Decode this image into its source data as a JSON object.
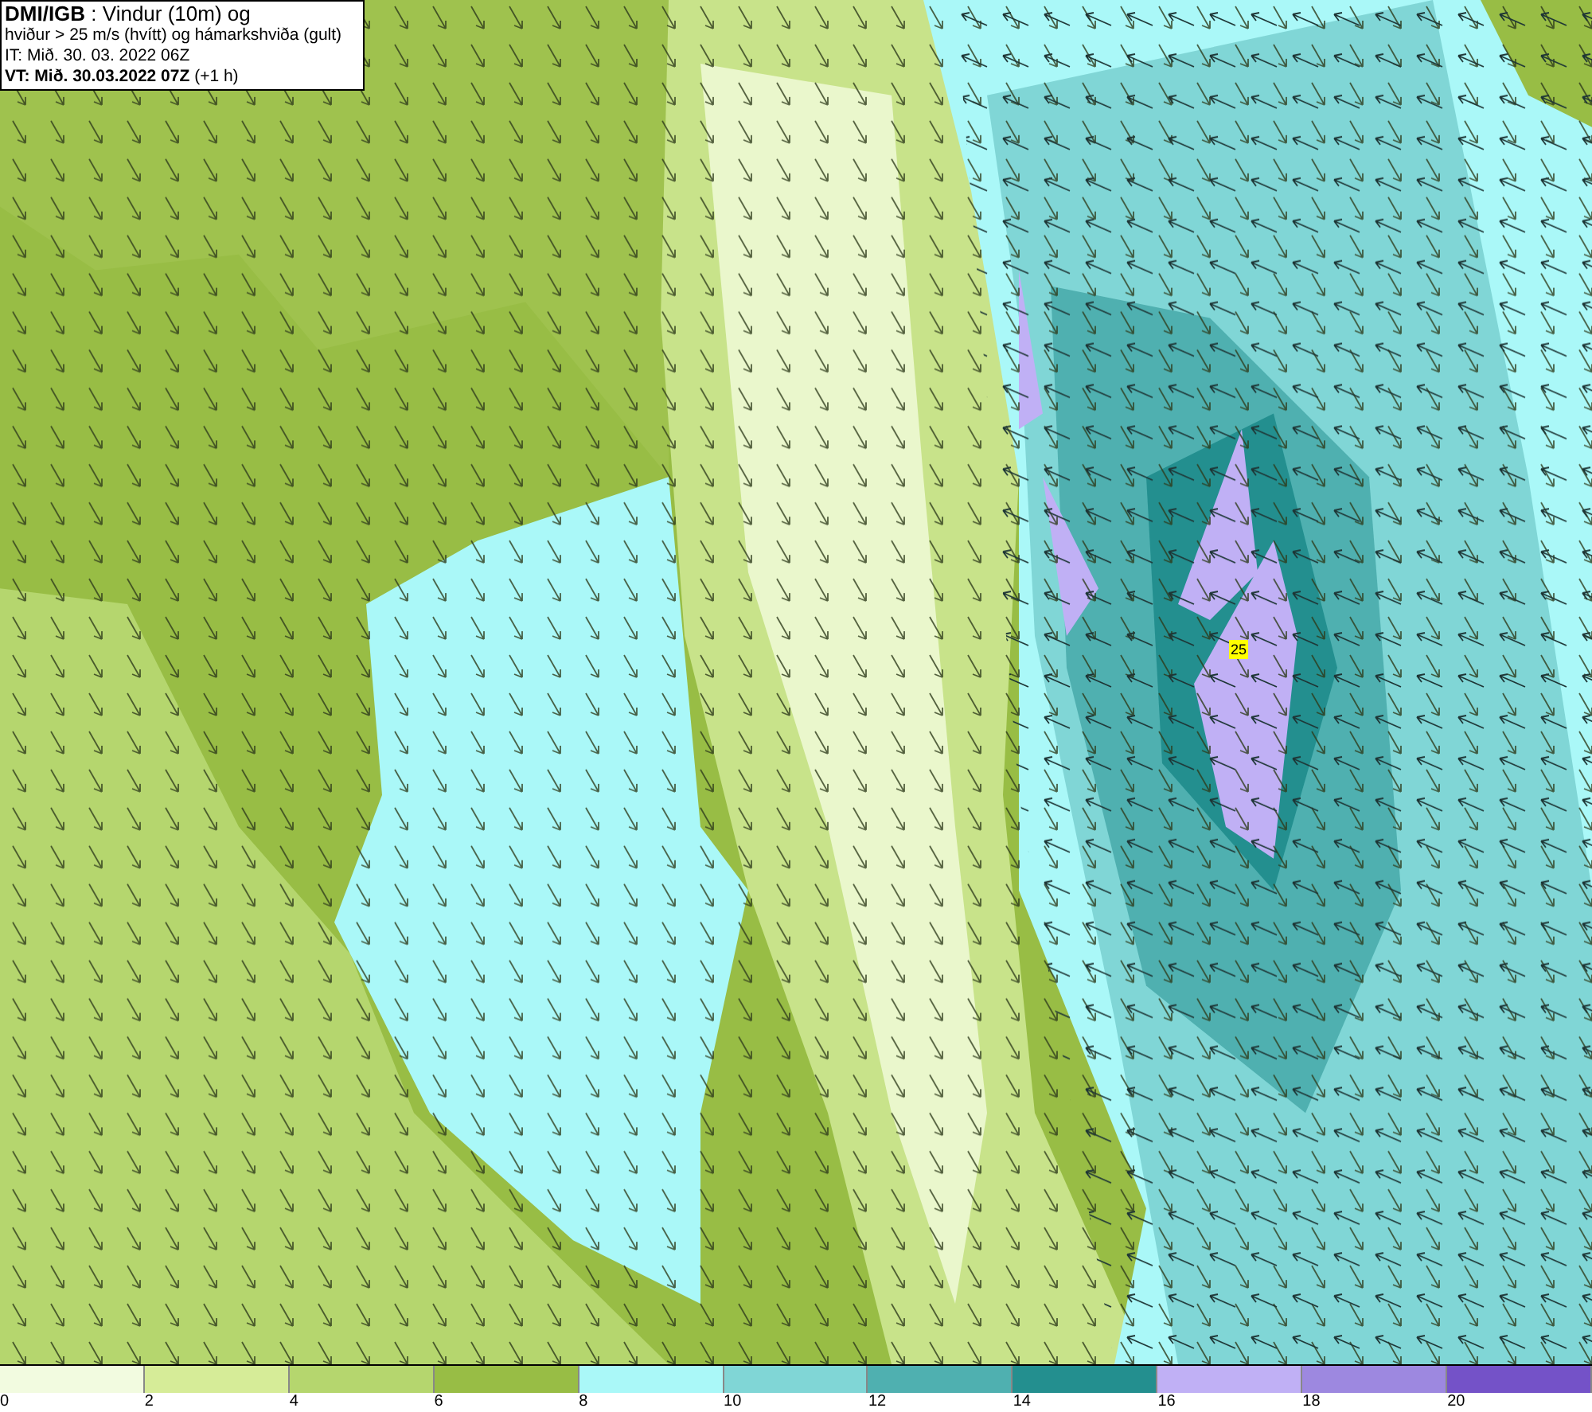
{
  "header": {
    "lines": [
      "**DMI/IGB** : Vindur (10m) og",
      "hviður > 25 m/s (hvítt) og hámarkshviða (gult)",
      "IT: Mið. 30. 03. 2022 06Z",
      "**VT: Mið. 30.03.2022 07Z** (+1 h)"
    ]
  },
  "map": {
    "gust_marker": "25"
  },
  "legend": [
    {
      "label": "0",
      "color": "#f2fbe0"
    },
    {
      "label": "2",
      "color": "#d6ec98"
    },
    {
      "label": "4",
      "color": "#b5d66e"
    },
    {
      "label": "6",
      "color": "#98bd45"
    },
    {
      "label": "8",
      "color": "#aaf8f8"
    },
    {
      "label": "10",
      "color": "#80d6d6"
    },
    {
      "label": "12",
      "color": "#4fb0b0"
    },
    {
      "label": "14",
      "color": "#238f8f"
    },
    {
      "label": "16",
      "color": "#c0b0f5"
    },
    {
      "label": "18",
      "color": "#9d88e0"
    },
    {
      "label": "20",
      "color": "#7452c8"
    }
  ]
}
